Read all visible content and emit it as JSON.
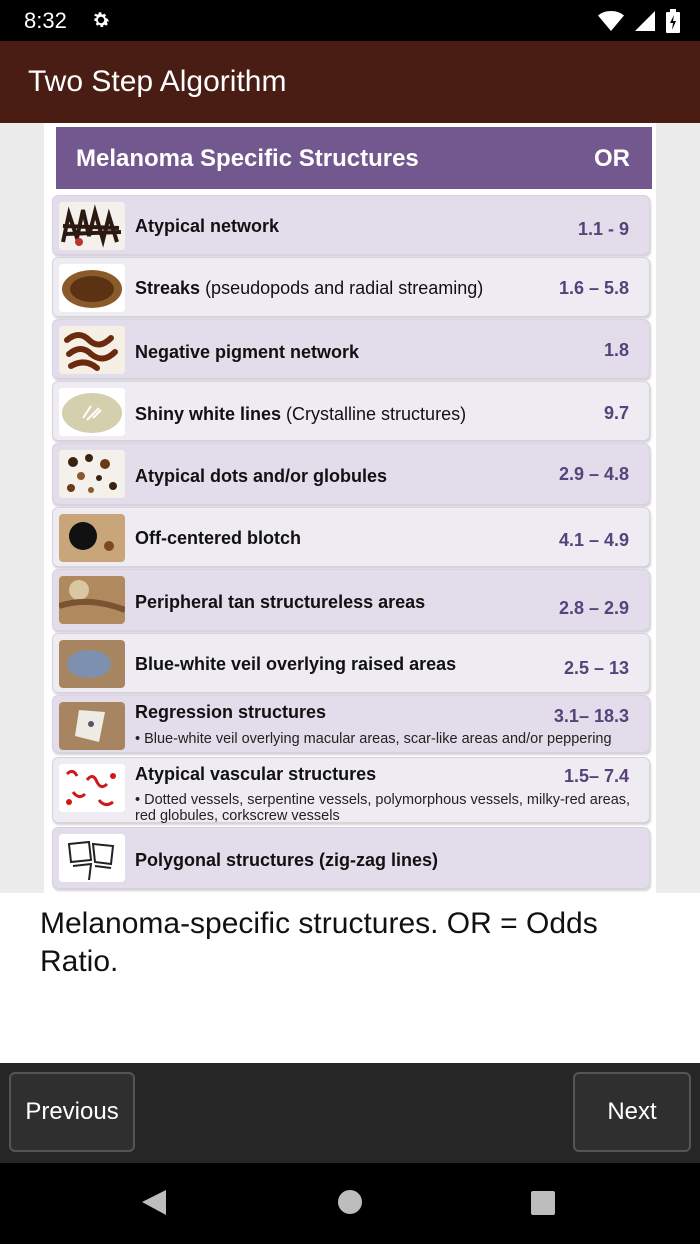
{
  "status": {
    "time": "8:32"
  },
  "app": {
    "title": "Two Step Algorithm"
  },
  "table": {
    "header_title": "Melanoma Specific Structures",
    "header_or": "OR",
    "rows": [
      {
        "name_bold": "Atypical network",
        "name_rest": "",
        "or": "1.1 - 9",
        "sub": ""
      },
      {
        "name_bold": "Streaks",
        "name_rest": " (pseudopods and radial streaming)",
        "or": "1.6 – 5.8",
        "sub": ""
      },
      {
        "name_bold": "Negative pigment network",
        "name_rest": "",
        "or": "1.8",
        "sub": ""
      },
      {
        "name_bold": "Shiny white lines",
        "name_rest": " (Crystalline structures)",
        "or": "9.7",
        "sub": ""
      },
      {
        "name_bold": "Atypical dots and/or globules",
        "name_rest": "",
        "or": "2.9 – 4.8",
        "sub": ""
      },
      {
        "name_bold": "Off-centered blotch",
        "name_rest": "",
        "or": "4.1 – 4.9",
        "sub": ""
      },
      {
        "name_bold": "Peripheral tan structureless areas",
        "name_rest": "",
        "or": "2.8 – 2.9",
        "sub": ""
      },
      {
        "name_bold": "Blue-white veil overlying raised areas",
        "name_rest": "",
        "or": "2.5 – 13",
        "sub": ""
      },
      {
        "name_bold": "Regression structures",
        "name_rest": "",
        "or": "3.1– 18.3",
        "sub": "• Blue-white veil overlying macular areas, scar-like areas and/or peppering"
      },
      {
        "name_bold": "Atypical vascular structures",
        "name_rest": "",
        "or": "1.5– 7.4",
        "sub": "• Dotted vessels, serpentine vessels, polymorphous vessels, milky-red areas, red globules, corkscrew vessels"
      },
      {
        "name_bold": "Polygonal structures (zig-zag lines)",
        "name_rest": "",
        "or": "",
        "sub": ""
      }
    ]
  },
  "caption": "Melanoma-specific structures. OR = Odds Ratio.",
  "nav": {
    "previous": "Previous",
    "next": "Next"
  },
  "colors": {
    "appbar": "#4a1d14",
    "header": "#72588e",
    "row_dark": "#e3dceb",
    "row_light": "#efebf3",
    "or_text": "#56437a"
  }
}
